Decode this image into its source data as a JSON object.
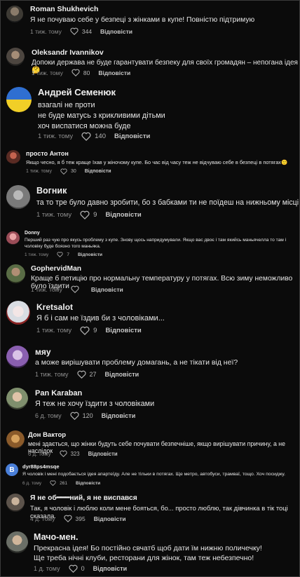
{
  "comments": [
    {
      "name": "Roman Shukhevich",
      "text": "Я не почуваю себе у безпеці з жінками в купе! Повністю підтримую",
      "time": "1 тиж. тому",
      "likes": "344",
      "reply": "Відповісти",
      "avatar": "avatar-man-helmet"
    },
    {
      "name": "Oleksandr Ivannikov",
      "text": "Допоки держава не буде гарантувати безпеку для своїх громадян – непогана ідея 🤔",
      "time": "1 тиж. тому",
      "likes": "80",
      "reply": "Відповісти",
      "avatar": "avatar-man-dark"
    },
    {
      "name": "Андрей Семенюк",
      "text": "взагалі не проти\nне буде матусь з крикливими дітьми\nхоч виспатися можна буде",
      "time": "1 тиж. тому",
      "likes": "140",
      "reply": "Відповісти",
      "avatar": "avatar-flag-field"
    },
    {
      "name": "просто Антон",
      "text": "Якщо чесно, я б теж краще їхав у жіночому купе. Бо час від часу теж не відчуваю себе в безпеці в потягах🙂",
      "time": "1 тиж. тому",
      "likes": "30",
      "reply": "Відповісти",
      "avatar": "avatar-person-red"
    },
    {
      "name": "Вогник",
      "text": "та то тре було давно зробити, бо з бабками ти не поїдеш на нижньому місці",
      "time": "1 тиж. тому",
      "likes": "9",
      "reply": "Відповісти",
      "avatar": "avatar-gray"
    },
    {
      "name": "Donny",
      "text": "Перший раз чую про якусь проблему з купе. Знову щось напридумували. Якщо вас двоє і там якийсь маньячелла то там і чоловіку буде боязно того маньяка.",
      "time": "1 тиж. тому",
      "likes": "7",
      "reply": "Відповісти",
      "avatar": "avatar-pink"
    },
    {
      "name": "GophervidMan",
      "text": "Краще б петицію про нормальну температуру у потягах. Всю зиму неможливо було їздити",
      "time": "1 тиж. тому",
      "likes": "",
      "reply": "Відповісти",
      "avatar": "avatar-man-outdoor"
    },
    {
      "name": "Kretsalot",
      "text": "Я б і сам не їздив би з чоловіками...",
      "time": "1 тиж. тому",
      "likes": "9",
      "reply": "Відповісти",
      "avatar": "avatar-anime"
    },
    {
      "name": "мяу",
      "text": "а може вирішувати проблему домагань, а не тікати від неї?",
      "time": "1 тиж. тому",
      "likes": "27",
      "reply": "Відповісти",
      "avatar": "avatar-purple"
    },
    {
      "name": "Pan Karaban",
      "text": "Я теж не хочу їздити з чоловіками",
      "time": "6 д. тому",
      "likes": "120",
      "reply": "Відповісти",
      "avatar": "avatar-man-light"
    },
    {
      "name": "Дон Вактор",
      "text": "мені здається, що жінки будуть себе почувати безпечніше, якщо вирішувати причину, а не наслідок",
      "time": "6 д. тому",
      "likes": "323",
      "reply": "Відповісти",
      "avatar": "avatar-dog"
    },
    {
      "name": "dyr88ps4msqe",
      "text": "Я чоловік і мені подобається ідея апартеїду. Але не тільки в потягах. Ще метро, автобуси, трамваї, тощо. Хоч посиджу.",
      "time": "6 д. тому",
      "likes": "261",
      "reply": "Відповісти",
      "avatar": "B"
    },
    {
      "name": "Я не об━━━ний, я не виспався",
      "text": "Так, я чоловік і люблю коли мене бояться, бо... просто люблю, так дівчинка в тік тоці сказала.",
      "time": "4 д. тому",
      "likes": "395",
      "reply": "Відповісти",
      "avatar": "avatar-man-dark2"
    },
    {
      "name": "Мачо-мен.",
      "text": "Прекрасна ідея! Бо постійно свчатб щоб дати їм нижню поличечку!\nЩе треба нічні клуби, ресторани для жінок, там теж небезпечно!",
      "time": "1 д. тому",
      "likes": "0",
      "reply": "Відповісти",
      "avatar": "avatar-man-street"
    }
  ]
}
